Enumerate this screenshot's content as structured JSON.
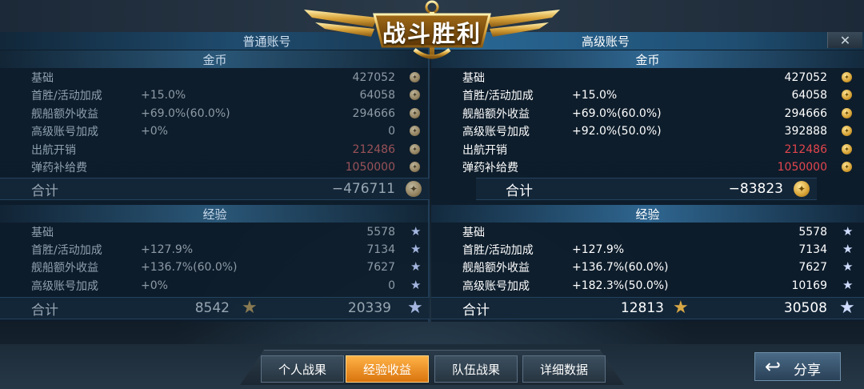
{
  "title": "战斗胜利",
  "close_label": "✕",
  "colors": {
    "negative_left": "#9a5259",
    "negative_right": "#e2454d",
    "active_tab": "#f08a1f"
  },
  "normal_account": {
    "header": "普通账号",
    "gold_title": "金币",
    "gold_rows": [
      {
        "label": "基础",
        "pct": "",
        "value": "427052"
      },
      {
        "label": "首胜/活动加成",
        "pct": "+15.0%",
        "value": "64058"
      },
      {
        "label": "舰船额外收益",
        "pct": "+69.0%(60.0%)",
        "value": "294666"
      },
      {
        "label": "高级账号加成",
        "pct": "+0%",
        "value": "0"
      },
      {
        "label": "出航开销",
        "pct": "",
        "value": "212486"
      },
      {
        "label": "弹药补给费",
        "pct": "",
        "value": "1050000"
      }
    ],
    "gold_total_label": "合计",
    "gold_total": "−476711",
    "exp_title": "经验",
    "exp_rows": [
      {
        "label": "基础",
        "pct": "",
        "value": "5578"
      },
      {
        "label": "首胜/活动加成",
        "pct": "+127.9%",
        "value": "7134"
      },
      {
        "label": "舰船额外收益",
        "pct": "+136.7%(60.0%)",
        "value": "7627"
      },
      {
        "label": "高级账号加成",
        "pct": "+0%",
        "value": "0"
      }
    ],
    "exp_total_label": "合计",
    "exp_total_gold": "8542",
    "exp_total": "20339"
  },
  "premium_account": {
    "header": "高级账号",
    "gold_title": "金币",
    "gold_rows": [
      {
        "label": "基础",
        "pct": "",
        "value": "427052"
      },
      {
        "label": "首胜/活动加成",
        "pct": "+15.0%",
        "value": "64058"
      },
      {
        "label": "舰船额外收益",
        "pct": "+69.0%(60.0%)",
        "value": "294666"
      },
      {
        "label": "高级账号加成",
        "pct": "+92.0%(50.0%)",
        "value": "392888"
      },
      {
        "label": "出航开销",
        "pct": "",
        "value": "212486"
      },
      {
        "label": "弹药补给费",
        "pct": "",
        "value": "1050000"
      }
    ],
    "gold_total_label": "合计",
    "gold_total": "−83823",
    "exp_title": "经验",
    "exp_rows": [
      {
        "label": "基础",
        "pct": "",
        "value": "5578"
      },
      {
        "label": "首胜/活动加成",
        "pct": "+127.9%",
        "value": "7134"
      },
      {
        "label": "舰船额外收益",
        "pct": "+136.7%(60.0%)",
        "value": "7627"
      },
      {
        "label": "高级账号加成",
        "pct": "+182.3%(50.0%)",
        "value": "10169"
      }
    ],
    "exp_total_label": "合计",
    "exp_total_gold": "12813",
    "exp_total": "30508"
  },
  "tabs": [
    {
      "label": "个人战果",
      "active": false
    },
    {
      "label": "经验收益",
      "active": true
    },
    {
      "label": "队伍战果",
      "active": false
    },
    {
      "label": "详细数据",
      "active": false
    }
  ],
  "share_label": "分享",
  "icons": {
    "gold": "gold-coin-icon",
    "exp": "silver-star-icon",
    "gold_exp": "gold-star-icon",
    "share": "share-arrow-icon",
    "close": "close-icon"
  }
}
